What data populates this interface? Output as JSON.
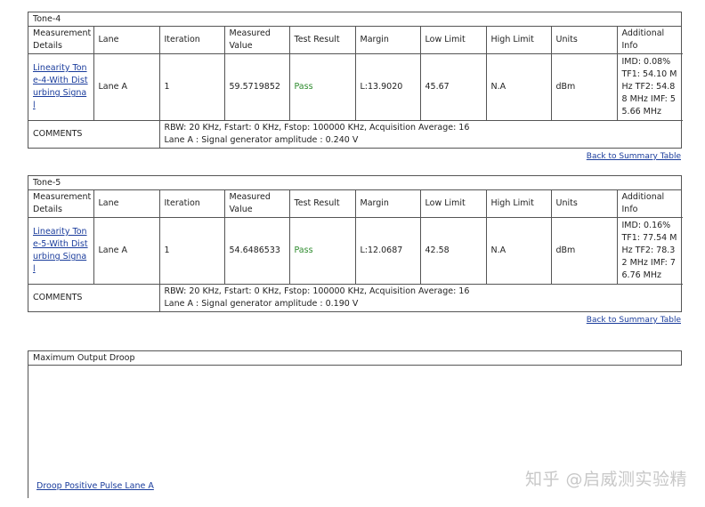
{
  "headers": {
    "measurement_details": "Measurement Details",
    "lane": "Lane",
    "iteration": "Iteration",
    "measured_value": "Measured Value",
    "test_result": "Test Result",
    "margin": "Margin",
    "low_limit": "Low Limit",
    "high_limit": "High Limit",
    "units": "Units",
    "additional_info": "Additional Info"
  },
  "tables": [
    {
      "title": "Tone-4",
      "row": {
        "measurement": "Linearity Tone-4-With Disturbing Signal",
        "lane": "Lane A",
        "iteration": "1",
        "measured_value": "59.5719852",
        "result": "Pass",
        "margin": "L:13.9020",
        "low_limit": "45.67",
        "high_limit": "N.A",
        "units": "dBm",
        "additional_info": "IMD: 0.08% TF1: 54.10 MHz TF2: 54.88 MHz IMF: 55.66 MHz"
      },
      "comments_label": "COMMENTS",
      "comment_line1": "RBW: 20 KHz, Fstart: 0 KHz, Fstop: 100000 KHz, Acquisition Average: 16",
      "comment_line2": "Lane A : Signal generator amplitude : 0.240 V",
      "back_link": "Back to Summary Table"
    },
    {
      "title": "Tone-5",
      "row": {
        "measurement": "Linearity Tone-5-With Disturbing Signal",
        "lane": "Lane A",
        "iteration": "1",
        "measured_value": "54.6486533",
        "result": "Pass",
        "margin": "L:12.0687",
        "low_limit": "42.58",
        "high_limit": "N.A",
        "units": "dBm",
        "additional_info": "IMD: 0.16% TF1: 77.54 MHz TF2: 78.32 MHz IMF: 76.76 MHz"
      },
      "comments_label": "COMMENTS",
      "comment_line1": "RBW: 20 KHz, Fstart: 0 KHz, Fstop: 100000 KHz, Acquisition Average: 16",
      "comment_line2": "Lane A : Signal generator amplitude : 0.190 V",
      "back_link": "Back to Summary Table"
    }
  ],
  "droop": {
    "title": "Maximum Output Droop",
    "link": "Droop Positive Pulse Lane A"
  },
  "watermark": "知乎 @启威测实验精",
  "colors": {
    "link": "#1a3c9c",
    "pass": "#2e8b2e",
    "border": "#555555"
  }
}
